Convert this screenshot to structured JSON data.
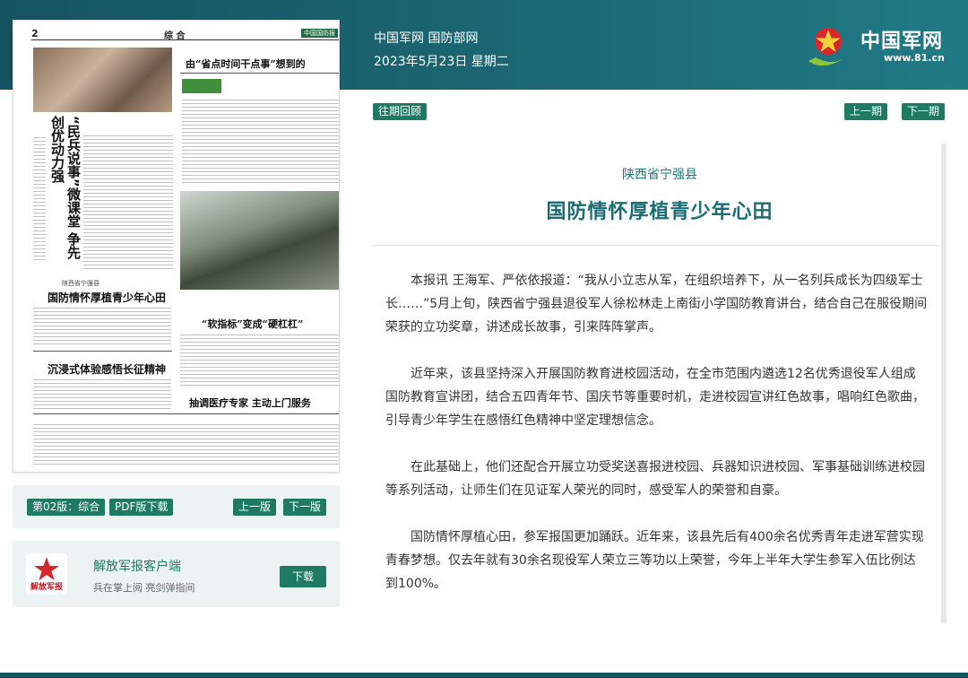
{
  "header": {
    "site_name": "中国军网 国防部网",
    "date": "2023年5月23日 星期二",
    "logo_text": "中国军网",
    "logo_url": "www.81.cn"
  },
  "paper": {
    "page_no": "2",
    "section": "综 合",
    "brand": "中国国防报",
    "story1_title": "“民兵说事”微课堂 争先创优动力强",
    "story2_title": "由“省点时间干点事”想到的",
    "story3_kicker": "陕西省宁强县",
    "story3_title": "国防情怀厚植青少年心田",
    "story4_title": "沉浸式体验感悟长征精神",
    "story5_title": "“软指标”变成“硬杠杠”",
    "story6_title": "抽调医疗专家 主动上门服务"
  },
  "controls": {
    "edition_label": "第02版：综合",
    "pdf_label": "PDF版下载",
    "prev_page": "上一版",
    "next_page": "下一版"
  },
  "app": {
    "name": "解放军报客户端",
    "slogan": "兵在掌上阅 亮剑弹指间",
    "download": "下载",
    "icon_text": "解放军报"
  },
  "issue_nav": {
    "past": "往期回顾",
    "prev": "上一期",
    "next": "下一期"
  },
  "article": {
    "region": "陕西省宁强县",
    "title": "国防情怀厚植青少年心田",
    "paragraphs": [
      "本报讯 王海军、严依依报道：“我从小立志从军，在组织培养下，从一名列兵成长为四级军士长……”5月上旬，陕西省宁强县退役军人徐松林走上南街小学国防教育讲台，结合自己在服役期间荣获的立功奖章，讲述成长故事，引来阵阵掌声。",
      "近年来，该县坚持深入开展国防教育进校园活动，在全市范围内遴选12名优秀退役军人组成国防教育宣讲团，结合五四青年节、国庆节等重要时机，走进校园宣讲红色故事，唱响红色歌曲，引导青少年学生在感悟红色精神中坚定理想信念。",
      "在此基础上，他们还配合开展立功受奖送喜报进校园、兵器知识进校园、军事基础训练进校园等系列活动，让师生们在见证军人荣光的同时，感受军人的荣誉和自豪。",
      "国防情怀厚植心田，参军报国更加踊跃。近年来，该县先后有400余名优秀青年走进军营实现青春梦想。仅去年就有30余名现役军人荣立三等功以上荣誉，今年上半年大学生参军入伍比例达到100%。"
    ]
  },
  "colors": {
    "header_bg": "#1c6874",
    "accent_green": "#1f7a63",
    "title_teal": "#1b6c75"
  }
}
